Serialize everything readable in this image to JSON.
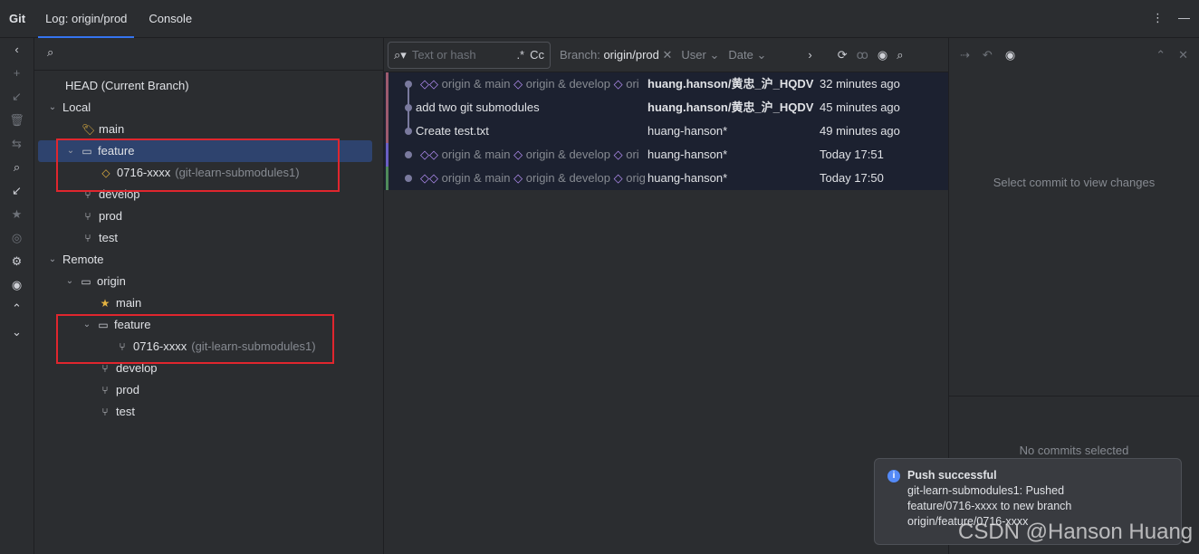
{
  "tabs": {
    "title": "Git",
    "log": "Log: origin/prod",
    "console": "Console"
  },
  "tree": {
    "head": "HEAD (Current Branch)",
    "local": "Local",
    "local_main": "main",
    "local_feature": "feature",
    "local_branch": "0716-xxxx",
    "local_branch_repo": "(git-learn-submodules1)",
    "local_develop": "develop",
    "local_prod": "prod",
    "local_test": "test",
    "remote": "Remote",
    "origin": "origin",
    "remote_main": "main",
    "remote_feature": "feature",
    "remote_branch": "0716-xxxx",
    "remote_branch_repo": "(git-learn-submodules1)",
    "remote_develop": "develop",
    "remote_prod": "prod",
    "remote_test": "test"
  },
  "log": {
    "search_placeholder": "Text or hash",
    "regex": ".*",
    "case": "Cc",
    "branch_label": "Branch:",
    "branch_value": "origin/prod",
    "user": "User",
    "date": "Date",
    "commits": [
      {
        "tags": "origin & main",
        "tags2": "origin & develop",
        "tags3": "ori",
        "author": "huang.hanson/黄忠_沪_HQDV",
        "date": "32 minutes ago",
        "bold": true,
        "color": "#9c5a6e"
      },
      {
        "message": "add two git submodules",
        "author": "huang.hanson/黄忠_沪_HQDV",
        "date": "45 minutes ago",
        "bold": true,
        "color": "#9c5a6e"
      },
      {
        "message": "Create test.txt",
        "author": "huang-hanson*",
        "date": "49 minutes ago",
        "color": "#9c5a6e"
      },
      {
        "tags": "origin & main",
        "tags2": "origin & develop",
        "tags3": "ori",
        "author": "huang-hanson*",
        "date": "Today 17:51",
        "color": "#6a5fc4"
      },
      {
        "tags": "origin & main",
        "tags2": "origin & develop",
        "tags3": "orig",
        "author": "huang-hanson*",
        "date": "Today 17:50",
        "color": "#4f8a5a"
      }
    ]
  },
  "details": {
    "select_msg": "Select commit to view changes",
    "no_commits": "No commits selected"
  },
  "notification": {
    "title": "Push successful",
    "line1": "git-learn-submodules1: Pushed",
    "line2": "feature/0716-xxxx to new branch",
    "line3": "origin/feature/0716-xxxx"
  },
  "watermark": "CSDN @Hanson Huang"
}
